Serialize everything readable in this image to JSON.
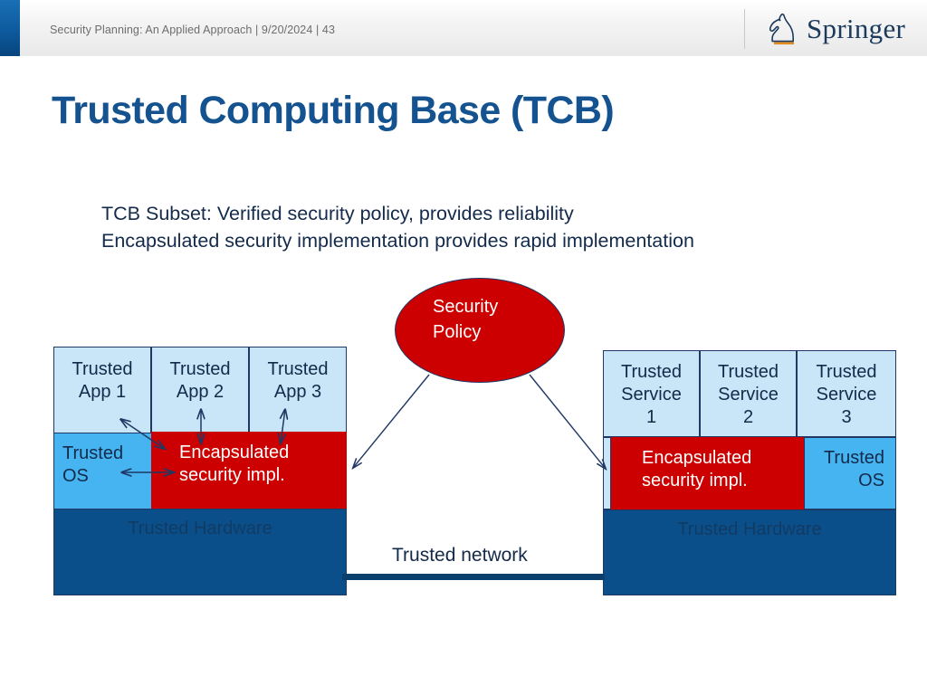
{
  "header": {
    "meta": "Security Planning: An Applied Approach | 9/20/2024 | 43",
    "brand": "Springer",
    "brand_icon": "springer-knight-icon",
    "accent_color": "#0d5a9e",
    "brand_color": "#1b3a5c",
    "rule_color": "#e08a1e"
  },
  "slide": {
    "title": "Trusted Computing Base (TCB)",
    "title_color": "#14538f",
    "body": [
      "TCB Subset: Verified security policy, provides reliability",
      "Encapsulated security implementation provides rapid implementation"
    ]
  },
  "diagram": {
    "policy": {
      "line1": "Security",
      "line2": "Policy",
      "fill": "#cc0000",
      "text_color": "#ffffff"
    },
    "network": {
      "label": "Trusted network",
      "link_color": "#0a3f6e"
    },
    "colors": {
      "app": "#c9e5f8",
      "os": "#46b4f0",
      "impl": "#cc0000",
      "hardware": "#0a4f8a",
      "outline": "#1f3864",
      "text": "#132a4a"
    },
    "left_stack": {
      "apps": [
        {
          "line1": "Trusted",
          "line2": "App 1"
        },
        {
          "line1": "Trusted",
          "line2": "App 2"
        },
        {
          "line1": "Trusted",
          "line2": "App 3"
        }
      ],
      "os": {
        "line1": "Trusted",
        "line2": "OS"
      },
      "impl": {
        "line1": "Encapsulated",
        "line2": "security impl."
      },
      "hardware": "Trusted Hardware"
    },
    "right_stack": {
      "services": [
        {
          "line1": "Trusted",
          "line2": "Service",
          "line3": "1"
        },
        {
          "line1": "Trusted",
          "line2": "Service",
          "line3": "2"
        },
        {
          "line1": "Trusted",
          "line2": "Service",
          "line3": "3"
        }
      ],
      "impl": {
        "line1": "Encapsulated",
        "line2": "security impl."
      },
      "os": {
        "line1": "Trusted",
        "line2": "OS"
      },
      "hardware": "Trusted Hardware"
    }
  }
}
